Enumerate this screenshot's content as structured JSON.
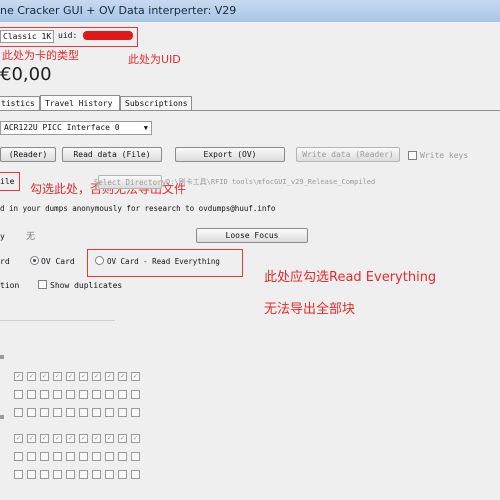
{
  "window": {
    "title": "ne Cracker GUI + OV Data interperter: V29"
  },
  "card": {
    "type_value": "Classic 1K",
    "uid_label": "uid:",
    "balance": "€0,00"
  },
  "annotations": {
    "card_type": "此处为卡的类型",
    "uid": "此处为UID",
    "file_check": "勾选此处，否则无法导出文件",
    "read_everything_line1": "此处应勾选Read Everything",
    "read_everything_line2": "无法导出全部块"
  },
  "tabs": [
    {
      "label": "tistics"
    },
    {
      "label": "Travel History"
    },
    {
      "label": "Subscriptions"
    }
  ],
  "reader": {
    "selected": "ACR122U PICC Interface 0"
  },
  "toolbar": {
    "reader_btn": "(Reader)",
    "read_file_btn": "Read data (File)",
    "export_btn": "Export (OV)",
    "write_btn": "Write data (Reader)",
    "write_keys_label": "Write keys"
  },
  "file_row": {
    "file_label": "ile",
    "select_dir_btn": "Select Directory",
    "path_value": "D:\\刷卡工具\\RFID tools\\mfocGUI_v29_Release_Compiled"
  },
  "notice": "d in your dumps anonymously for research to ovdumps@huuf.info",
  "key_row": {
    "label": "y",
    "value": "无",
    "loose_focus_btn": "Loose Focus"
  },
  "mode": {
    "card_label": "rd",
    "ov_card": "OV Card",
    "ov_card_read_everything": "OV Card - Read Everything"
  },
  "options": {
    "option_label": "tion",
    "show_duplicates": "Show duplicates"
  },
  "grid": {
    "row1": [
      "✓",
      "✓",
      "✓",
      "✓",
      "✓",
      "✓",
      "✓",
      "✓",
      "✓",
      "✓"
    ],
    "row2": [
      "",
      "",
      "",
      "",
      "",
      "",
      "",
      "",
      "",
      ""
    ],
    "row3": [
      "",
      "",
      "",
      "",
      "",
      "",
      "",
      "",
      "",
      ""
    ],
    "row4": [
      "✓",
      "✓",
      "✓",
      "✓",
      "✓",
      "✓",
      "✓",
      "✓",
      "✓",
      "✓"
    ],
    "row5": [
      "",
      "",
      "",
      "",
      "",
      "",
      "",
      "",
      "",
      ""
    ],
    "row6": [
      "",
      "",
      "",
      "",
      "",
      "",
      "",
      "",
      "",
      ""
    ]
  },
  "colors": {
    "annotation_red": "#e52b2b",
    "titlebar": "#b7cfea"
  }
}
